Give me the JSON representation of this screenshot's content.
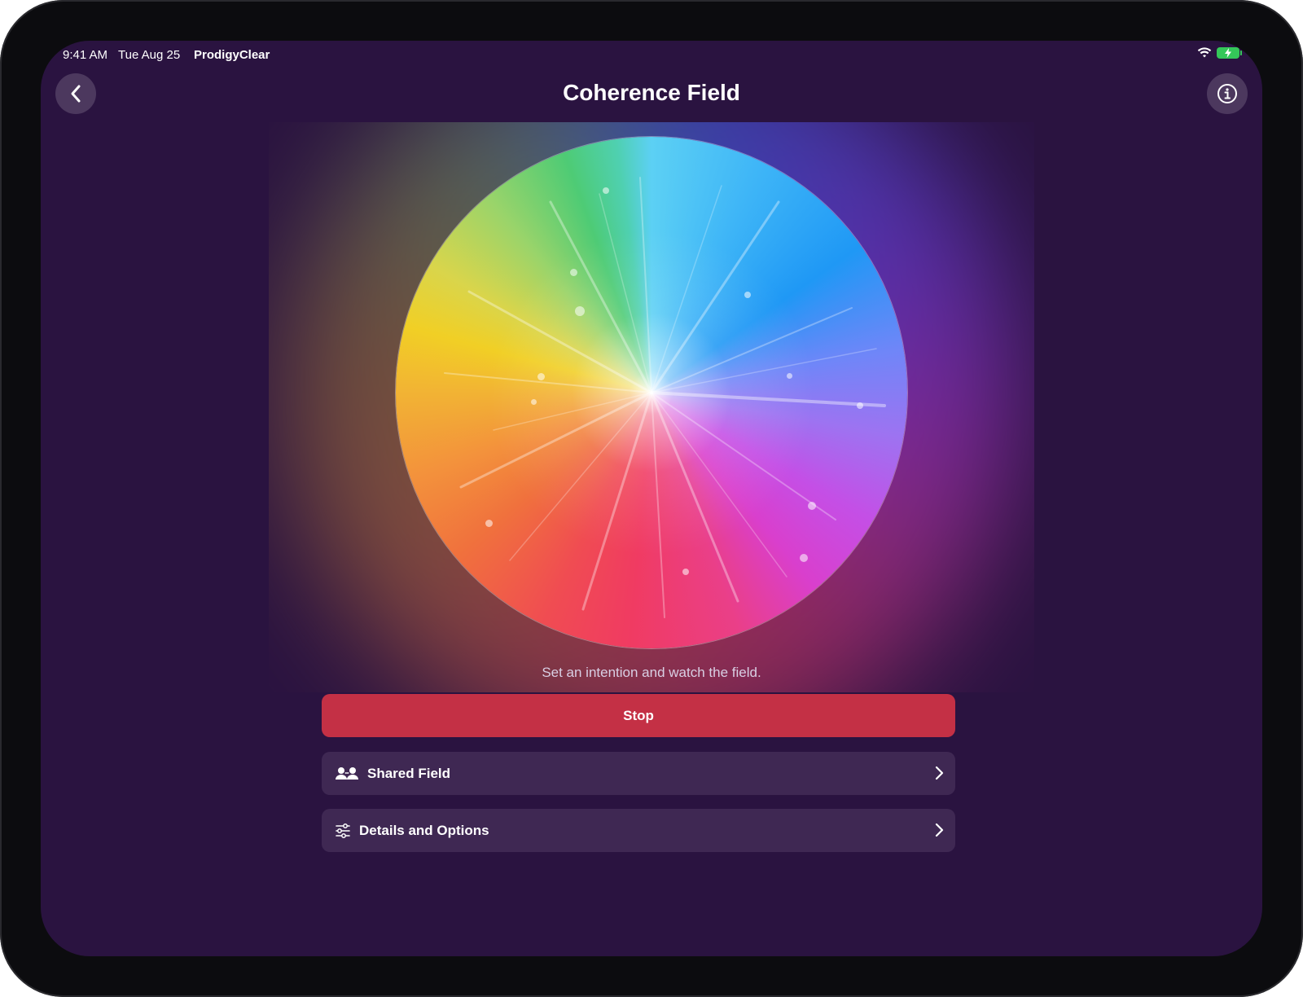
{
  "status": {
    "time": "9:41 AM",
    "date": "Tue Aug 25",
    "app_name": "ProdigyClear"
  },
  "header": {
    "title": "Coherence Field",
    "back_icon": "chevron-left-icon",
    "info_icon": "info-circle-icon"
  },
  "field": {
    "prompt": "Set an intention and watch the field."
  },
  "controls": {
    "stop_label": "Stop",
    "stop_color": "#c43045",
    "rows": [
      {
        "label": "Shared Field",
        "icon": "people-icon"
      },
      {
        "label": "Details and Options",
        "icon": "sliders-icon"
      }
    ]
  },
  "colors": {
    "background": "#2a1340",
    "row_background": "#3f2853",
    "battery": "#34c759"
  }
}
